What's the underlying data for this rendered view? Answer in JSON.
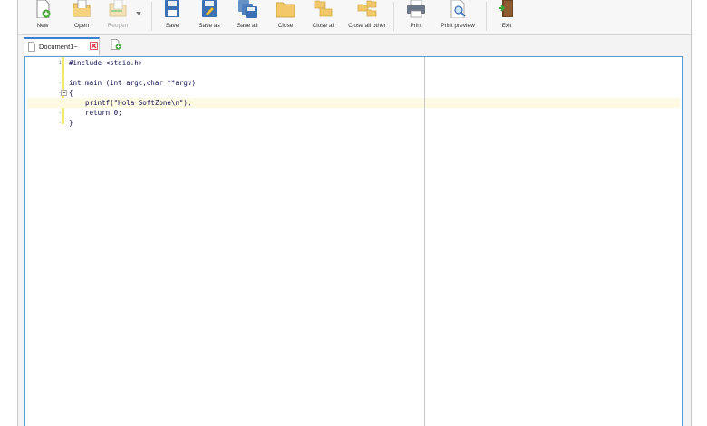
{
  "toolbar": {
    "new": "New",
    "open": "Open",
    "reopen": "Reopen",
    "save": "Save",
    "save_as": "Save as",
    "save_all": "Save all",
    "close": "Close",
    "close_all": "Close all",
    "close_all_other": "Close all other",
    "print": "Print",
    "print_preview": "Print preview",
    "exit": "Exit"
  },
  "tabs": {
    "active": "Document1~"
  },
  "editor": {
    "line_numbers": [
      "1",
      "-",
      "-",
      "-",
      "-",
      "6",
      "-",
      "-"
    ],
    "lines": [
      "#include <stdio.h>",
      "",
      "int main (int argc,char **argv)",
      "{",
      "    printf(\"Hola SoftZone\\n\");",
      "    return 0;",
      "}"
    ],
    "current_line": 5
  },
  "colors": {
    "accent": "#3b7fd4",
    "gutter_bar": "#f3e76a",
    "current_line_bg": "#fdf9e2",
    "close_tab_red": "#d9303b"
  }
}
